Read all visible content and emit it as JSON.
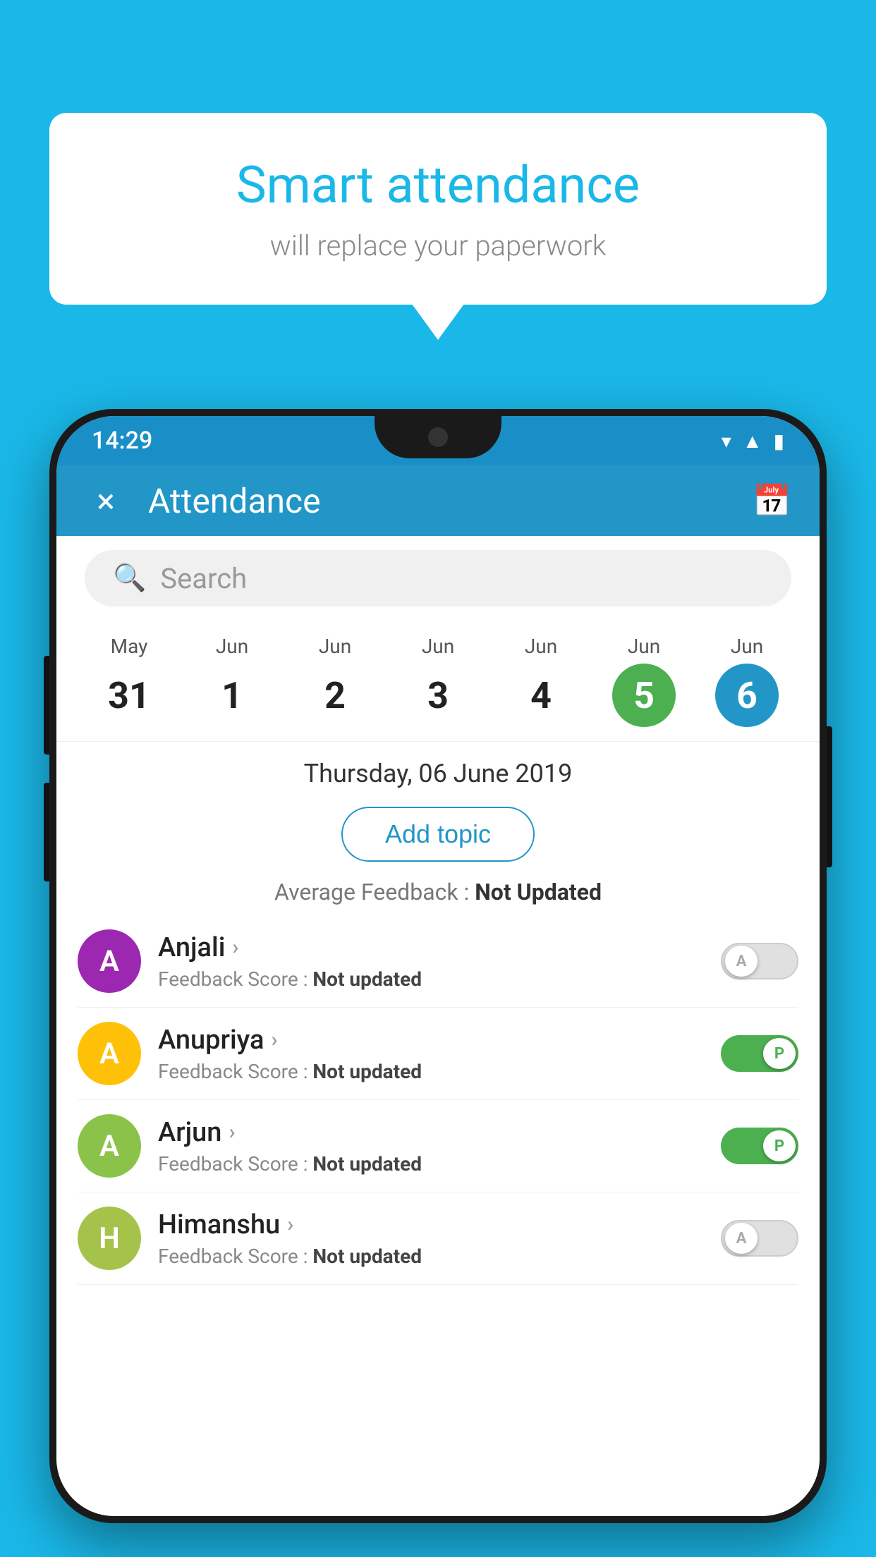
{
  "background_color": "#1ab8e8",
  "speech_bubble": {
    "title": "Smart attendance",
    "subtitle": "will replace your paperwork"
  },
  "status_bar": {
    "time": "14:29",
    "icons": [
      "wifi",
      "signal",
      "battery"
    ]
  },
  "app_header": {
    "title": "Attendance",
    "close_label": "×",
    "calendar_icon": "📅"
  },
  "search": {
    "placeholder": "Search"
  },
  "calendar": {
    "days": [
      {
        "month": "May",
        "date": "31",
        "state": "normal"
      },
      {
        "month": "Jun",
        "date": "1",
        "state": "normal"
      },
      {
        "month": "Jun",
        "date": "2",
        "state": "normal"
      },
      {
        "month": "Jun",
        "date": "3",
        "state": "normal"
      },
      {
        "month": "Jun",
        "date": "4",
        "state": "normal"
      },
      {
        "month": "Jun",
        "date": "5",
        "state": "today"
      },
      {
        "month": "Jun",
        "date": "6",
        "state": "selected"
      }
    ],
    "selected_date_label": "Thursday, 06 June 2019"
  },
  "add_topic_label": "Add topic",
  "average_feedback": {
    "label": "Average Feedback :",
    "value": "Not Updated"
  },
  "students": [
    {
      "name": "Anjali",
      "avatar_letter": "A",
      "avatar_color": "#9c27b0",
      "feedback_label": "Feedback Score :",
      "feedback_value": "Not updated",
      "attendance": "absent",
      "toggle_letter": "A"
    },
    {
      "name": "Anupriya",
      "avatar_letter": "A",
      "avatar_color": "#ffc107",
      "feedback_label": "Feedback Score :",
      "feedback_value": "Not updated",
      "attendance": "present",
      "toggle_letter": "P"
    },
    {
      "name": "Arjun",
      "avatar_letter": "A",
      "avatar_color": "#8bc34a",
      "feedback_label": "Feedback Score :",
      "feedback_value": "Not updated",
      "attendance": "present",
      "toggle_letter": "P"
    },
    {
      "name": "Himanshu",
      "avatar_letter": "H",
      "avatar_color": "#a5c34a",
      "feedback_label": "Feedback Score :",
      "feedback_value": "Not updated",
      "attendance": "absent",
      "toggle_letter": "A"
    }
  ]
}
